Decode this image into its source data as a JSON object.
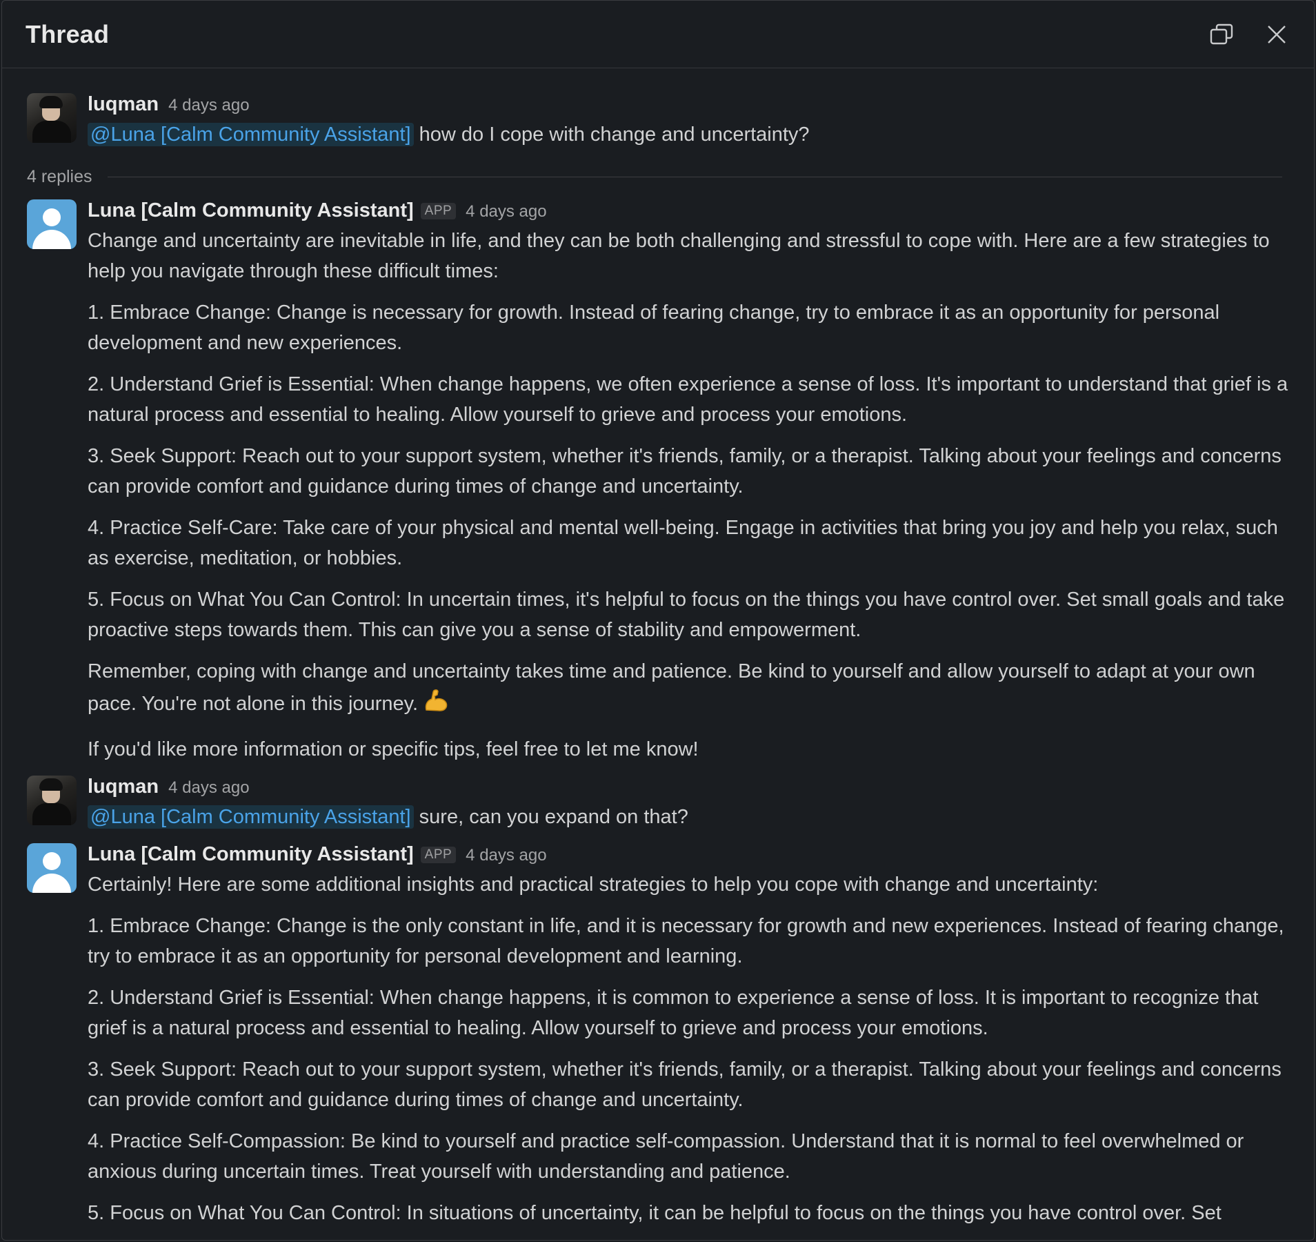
{
  "header": {
    "title": "Thread"
  },
  "thread": {
    "root": {
      "author": "luqman",
      "time": "4 days ago",
      "mention": "@Luna [Calm Community Assistant]",
      "text": "how do I cope with change and uncertainty?"
    },
    "replies_label": "4 replies",
    "replies": [
      {
        "author": "Luna [Calm Community Assistant]",
        "badge": "APP",
        "time": "4 days ago",
        "paragraphs": [
          "Change and uncertainty are inevitable in life, and they can be both challenging and stressful to cope with. Here are a few strategies to help you navigate through these difficult times:",
          "1. Embrace Change: Change is necessary for growth. Instead of fearing change, try to embrace it as an opportunity for personal development and new experiences.",
          "2. Understand Grief is Essential: When change happens, we often experience a sense of loss. It's important to understand that grief is a natural process and essential to healing. Allow yourself to grieve and process your emotions.",
          "3. Seek Support: Reach out to your support system, whether it's friends, family, or a therapist. Talking about your feelings and concerns can provide comfort and guidance during times of change and uncertainty.",
          "4. Practice Self-Care: Take care of your physical and mental well-being. Engage in activities that bring you joy and help you relax, such as exercise, meditation, or hobbies.",
          "5. Focus on What You Can Control: In uncertain times, it's helpful to focus on the things you have control over. Set small goals and take proactive steps towards them. This can give you a sense of stability and empowerment.",
          "Remember, coping with change and uncertainty takes time and patience. Be kind to yourself and allow yourself to adapt at your own pace. You're not alone in this journey.",
          "If you'd like more information or specific tips, feel free to let me know!"
        ],
        "emoji": "flexed-biceps"
      },
      {
        "author": "luqman",
        "time": "4 days ago",
        "mention": "@Luna [Calm Community Assistant]",
        "text": "sure, can you expand on that?"
      },
      {
        "author": "Luna [Calm Community Assistant]",
        "badge": "APP",
        "time": "4 days ago",
        "paragraphs": [
          "Certainly! Here are some additional insights and practical strategies to help you cope with change and uncertainty:",
          "1. Embrace Change: Change is the only constant in life, and it is necessary for growth and new experiences. Instead of fearing change, try to embrace it as an opportunity for personal development and learning.",
          "2. Understand Grief is Essential: When change happens, it is common to experience a sense of loss. It is important to recognize that grief is a natural process and essential to healing. Allow yourself to grieve and process your emotions.",
          "3. Seek Support: Reach out to your support system, whether it's friends, family, or a therapist. Talking about your feelings and concerns can provide comfort and guidance during times of change and uncertainty.",
          "4. Practice Self-Compassion: Be kind to yourself and practice self-compassion. Understand that it is normal to feel overwhelmed or anxious during uncertain times. Treat yourself with understanding and patience.",
          "5. Focus on What You Can Control: In situations of uncertainty, it can be helpful to focus on the things you have control over. Set"
        ]
      }
    ]
  }
}
